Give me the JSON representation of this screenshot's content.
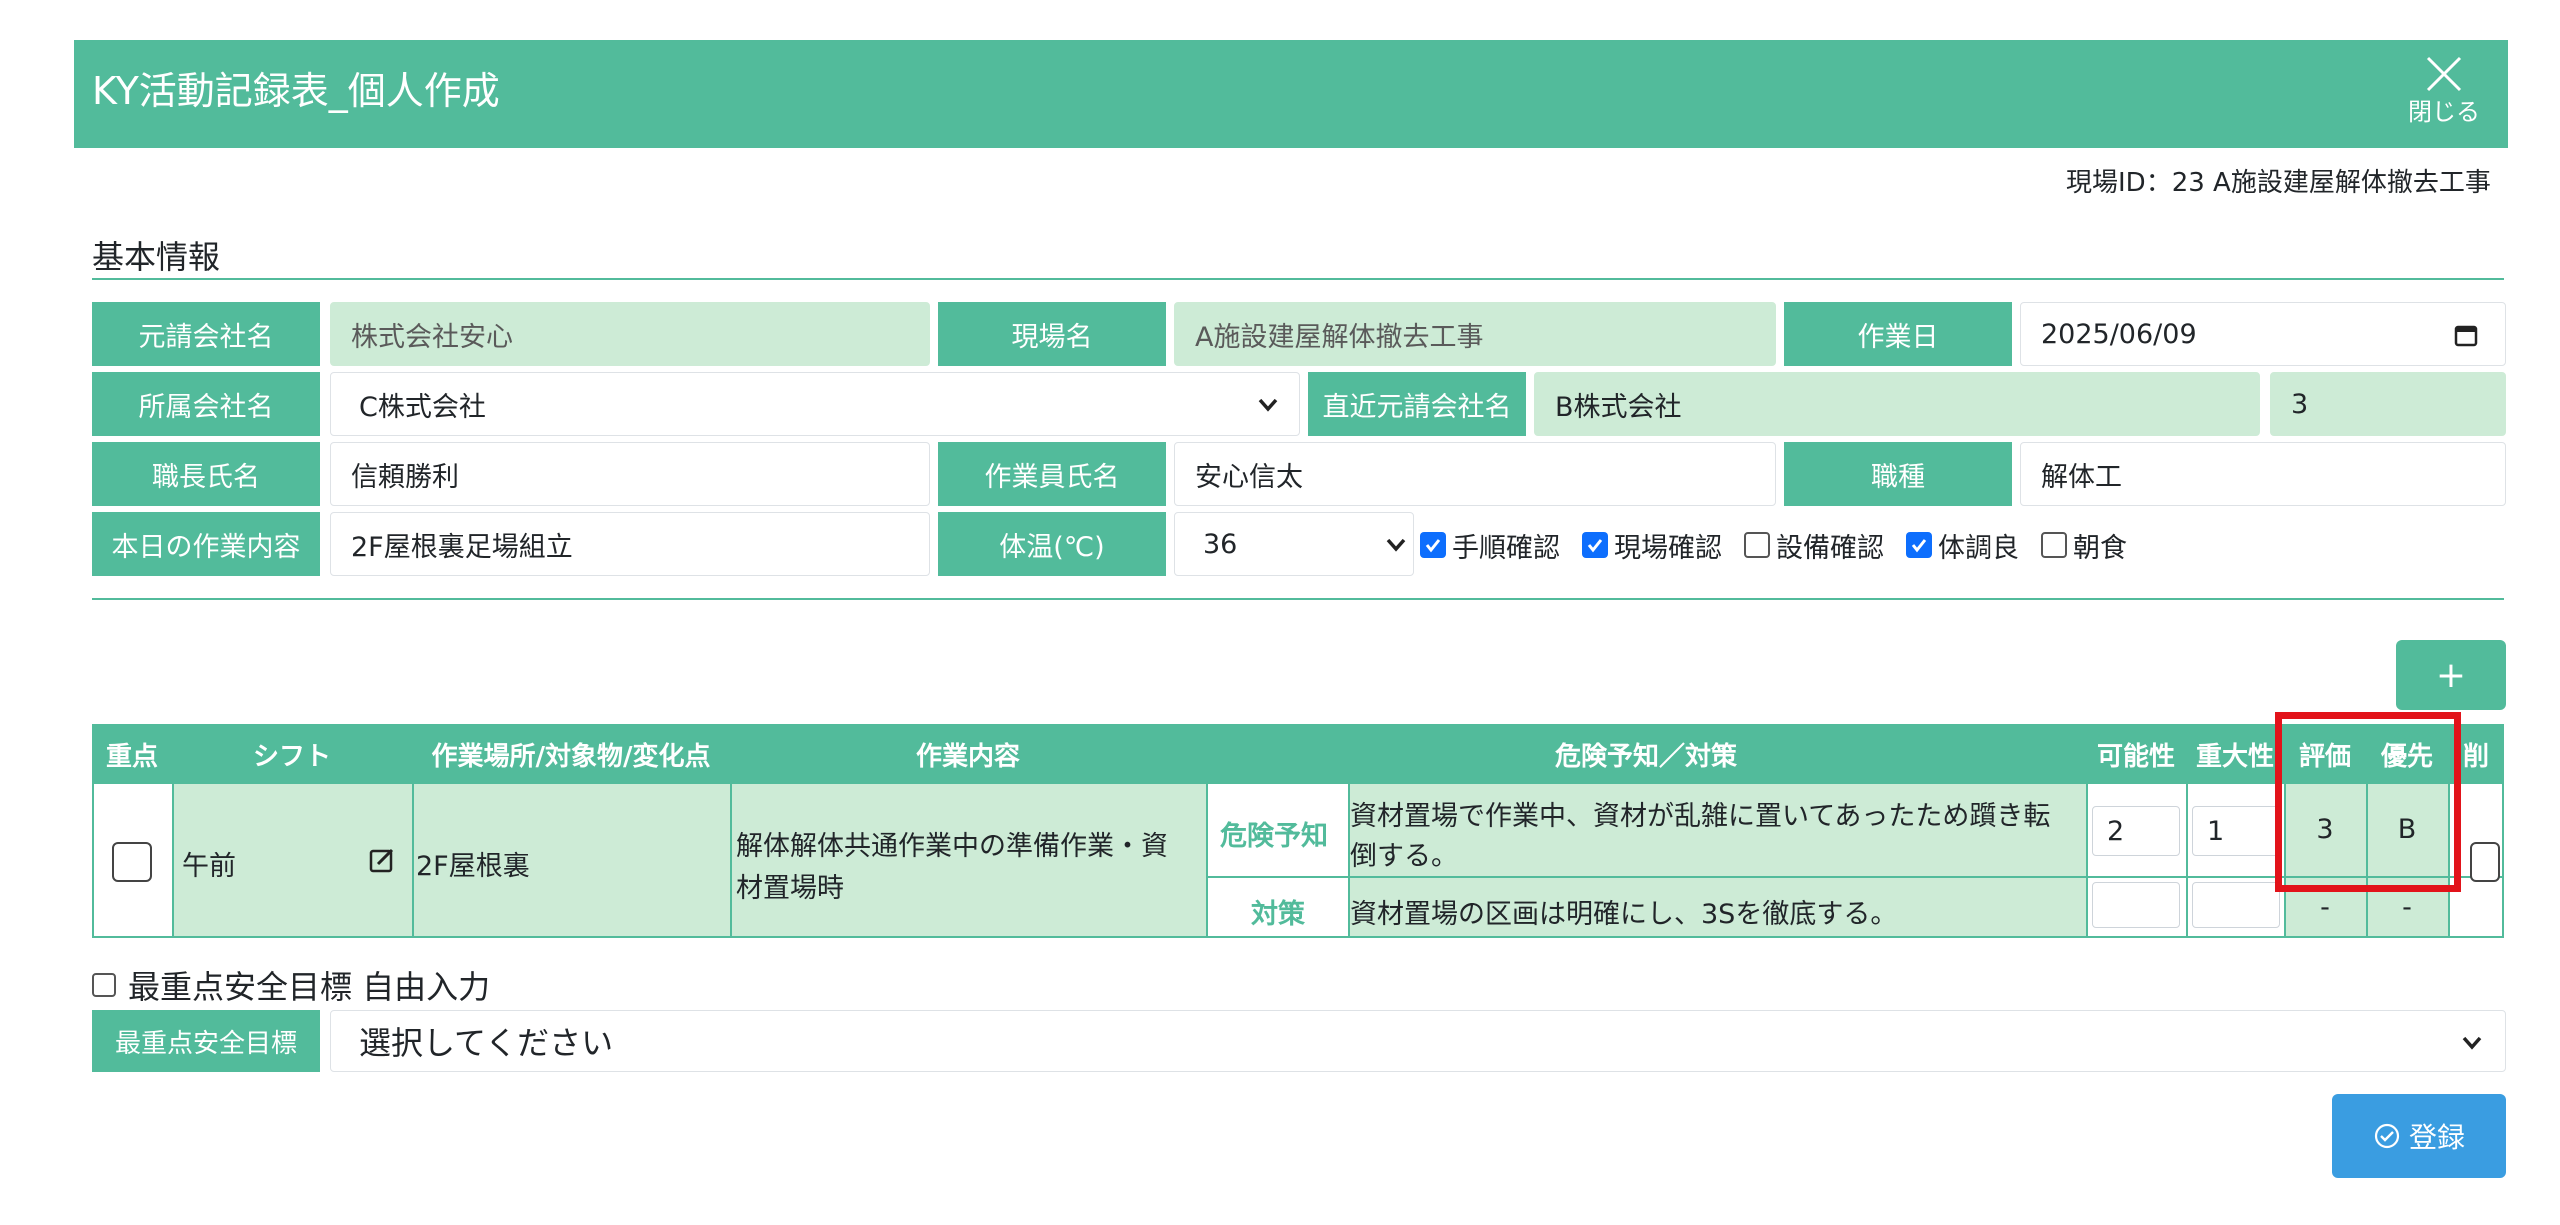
{
  "header": {
    "title": "KY活動記録表_個人作成",
    "close_label": "閉じる"
  },
  "site_id": "現場ID：23 A施設建屋解体撤去工事",
  "basic_info": {
    "section_title": "基本情報",
    "prime_contractor": {
      "label": "元請会社名",
      "value": "株式会社安心"
    },
    "site_name": {
      "label": "現場名",
      "value": "A施設建屋解体撤去工事"
    },
    "work_date": {
      "label": "作業日",
      "value": "2025/06/09"
    },
    "affiliated_company": {
      "label": "所属会社名",
      "value": "C株式会社"
    },
    "direct_contractor": {
      "label": "直近元請会社名",
      "value": "B株式会社",
      "extra": "3"
    },
    "foreman": {
      "label": "職長氏名",
      "value": "信頼勝利"
    },
    "worker": {
      "label": "作業員氏名",
      "value": "安心信太"
    },
    "trade": {
      "label": "職種",
      "value": "解体工"
    },
    "todays_work": {
      "label": "本日の作業内容",
      "value": "2F屋根裏足場組立"
    },
    "temperature": {
      "label": "体温(℃)",
      "value": "36"
    },
    "checks": [
      {
        "label": "手順確認",
        "checked": true
      },
      {
        "label": "現場確認",
        "checked": true
      },
      {
        "label": "設備確認",
        "checked": false
      },
      {
        "label": "体調良",
        "checked": true
      },
      {
        "label": "朝食",
        "checked": false
      }
    ]
  },
  "add_button": "+",
  "table": {
    "headers": {
      "priority_point": "重点",
      "shift": "シフト",
      "location": "作業場所/対象物/変化点",
      "work": "作業内容",
      "hazard": "危険予知／対策",
      "likelihood": "可能性",
      "severity": "重大性",
      "evaluation": "評価",
      "priority": "優先",
      "delete": "削"
    },
    "row": {
      "shift": "午前",
      "location": "2F屋根裏",
      "work_line1": "解体解体共通作業中の準備作業・資",
      "work_line2": "材置場時",
      "hazard_label": "危険予知",
      "hazard_line1": "資材置場で作業中、資材が乱雑に置いてあったため躓き転",
      "hazard_line2": "倒する。",
      "likelihood": "2",
      "severity": "1",
      "evaluation": "3",
      "priority": "B",
      "measure_label": "対策",
      "measure_text": "資材置場の区画は明確にし、3Sを徹底する。",
      "measure_likelihood": "",
      "measure_severity": "",
      "measure_evaluation": "-",
      "measure_priority": "-"
    }
  },
  "free_input_label": "最重点安全目標 自由入力",
  "safety_goal": {
    "label": "最重点安全目標",
    "placeholder": "選択してください"
  },
  "register_label": "登録",
  "colors": {
    "accent": "#52bb9b",
    "light": "#cdebd6",
    "button_blue": "#3a9de1",
    "highlight": "#e2131a"
  }
}
